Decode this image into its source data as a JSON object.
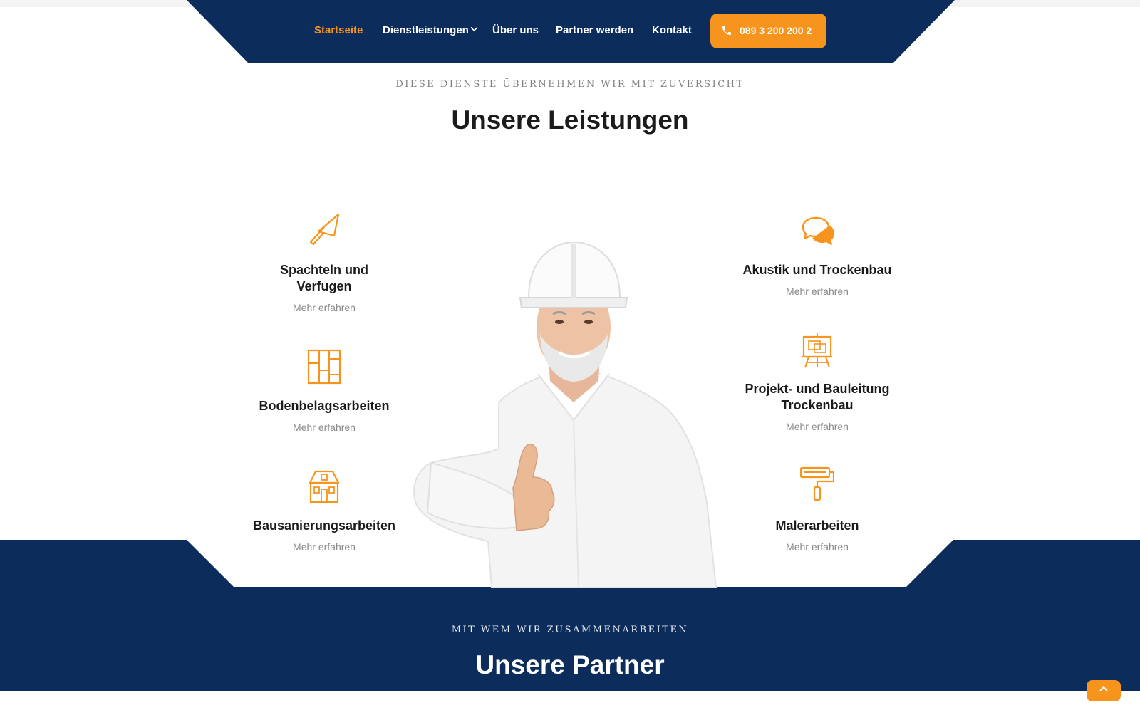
{
  "nav": {
    "items": [
      {
        "label": "Startseite",
        "active": true
      },
      {
        "label": "Dienstleistungen",
        "active": false
      },
      {
        "label": "Über uns",
        "active": false
      },
      {
        "label": "Partner werden",
        "active": false
      },
      {
        "label": "Kontakt",
        "active": false
      }
    ],
    "phone": "089 3 200 200 2",
    "phone_icon": "phone-icon"
  },
  "services_section": {
    "kicker": "DIESE DIENSTE ÜBERNEHMEN WIR MIT ZUVERSICHT",
    "title": "Unsere Leistungen",
    "more_label": "Mehr erfahren",
    "left": [
      {
        "title_l1": "Spachteln und",
        "title_l2": "Verfugen",
        "icon": "trowel-icon"
      },
      {
        "title_l1": "Bodenbelagsarbeiten",
        "title_l2": "",
        "icon": "floor-tiles-icon"
      },
      {
        "title_l1": "Bausanierungsarbeiten",
        "title_l2": "",
        "icon": "house-icon"
      }
    ],
    "right": [
      {
        "title_l1": "Akustik und Trockenbau",
        "title_l2": "",
        "icon": "speech-bubbles-icon"
      },
      {
        "title_l1": "Projekt- und Bauleitung",
        "title_l2": "Trockenbau",
        "icon": "blueprint-easel-icon"
      },
      {
        "title_l1": "Malerarbeiten",
        "title_l2": "",
        "icon": "paint-roller-icon"
      }
    ]
  },
  "partners_section": {
    "kicker": "MIT WEM WIR ZUSAMMENARBEITEN",
    "title": "Unsere Partner"
  },
  "colors": {
    "navy": "#0c2d5c",
    "accent": "#f7941d",
    "text_dark": "#1b1b1b",
    "text_muted": "#8a8a8a"
  }
}
